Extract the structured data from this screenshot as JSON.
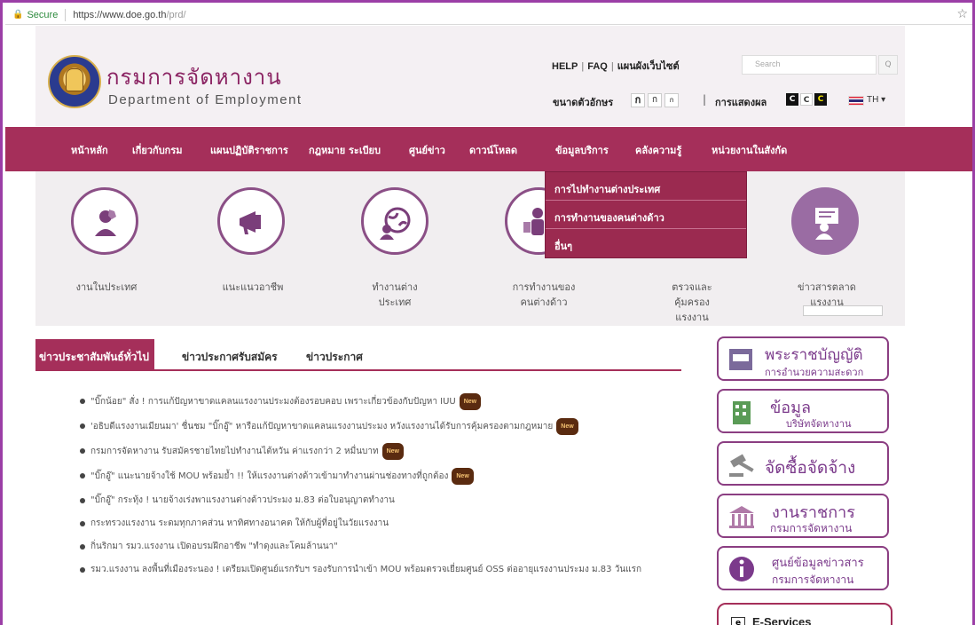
{
  "browser": {
    "secure_label": "Secure",
    "url_host": "https://www.doe.go.th",
    "url_path": "/prd/"
  },
  "header": {
    "title_th": "กรมการจัดหางาน",
    "title_en": "Department of Employment",
    "links": [
      "HELP",
      "FAQ",
      "แผนผังเว็บไซต์"
    ],
    "search_placeholder": "Search",
    "font_size_label": "ขนาดตัวอักษร",
    "font_size_options": [
      "ก",
      "ก",
      "ก"
    ],
    "display_label": "การแสดงผล",
    "contrast_options": [
      "C",
      "C",
      "C"
    ],
    "language": "TH"
  },
  "nav": {
    "items": [
      "หน้าหลัก",
      "เกี่ยวกับกรม",
      "แผนปฏิบัติราชการ",
      "กฎหมาย ระเบียบ",
      "ศูนย์ข่าว",
      "ดาวน์โหลด",
      "ข้อมูลบริการ",
      "คลังความรู้",
      "หน่วยงานในสังกัด"
    ],
    "dropdown": [
      "การไปทำงานต่างประเทศ",
      "การทำงานของคนต่างด้าว",
      "อื่นๆ"
    ]
  },
  "services": [
    {
      "line1": "งานในประเทศ",
      "line2": "",
      "line3": ""
    },
    {
      "line1": "แนะแนวอาชีพ",
      "line2": "",
      "line3": ""
    },
    {
      "line1": "ทำงานต่าง",
      "line2": "ประเทศ",
      "line3": ""
    },
    {
      "line1": "การทำงานของ",
      "line2": "คนต่างด้าว",
      "line3": ""
    },
    {
      "line1": "ตรวจและ",
      "line2": "คุ้มครอง",
      "line3": "แรงงาน"
    },
    {
      "line1": "ข่าวสารตลาด",
      "line2": "แรงงาน",
      "line3": ""
    }
  ],
  "news": {
    "tabs": [
      "ข่าวประชาสัมพันธ์ทั่วไป",
      "ข่าวประกาศรับสมัคร",
      "ข่าวประกาศ"
    ],
    "new_badge": "New",
    "items": [
      "\"บิ๊กน้อย\" สั่ง ! การแก้ปัญหาขาดแคลนแรงงานประมงต้องรอบคอบ เพราะเกี่ยวข้องกับปัญหา IUU",
      "'อธิบดีแรงงานเมียนมา' ชื่นชม \"บิ๊กอู๊\" หารือแก้ปัญหาขาดแคลนแรงงานประมง หวังแรงงานได้รับการคุ้มครองตามกฎหมาย",
      "กรมการจัดหางาน รับสมัครชายไทยไปทำงานไต้หวัน ค่าแรงกว่า 2 หมื่นบาท",
      "\"บิ๊กอู๊\" แนะนายจ้างใช้ MOU พร้อมย้ำ !! ให้แรงงานต่างด้าวเข้ามาทำงานผ่านช่องทางที่ถูกต้อง",
      "\"บิ๊กอู๊\" กระทุ้ง ! นายจ้างเร่งพาแรงงานต่างด้าวประมง ม.83 ต่อใบอนุญาตทำงาน",
      "กระทรวงแรงงาน ระดมทุกภาคส่วน หาทิศทางอนาคต ให้กับผู้ที่อยู่ในวัยแรงงาน",
      "กิ่นริกมา รมว.แรงงาน เปิดอบรมฝึกอาชีพ \"ทำดุงและโคมล้านนา\"",
      "รมว.แรงงาน ลงพื้นที่เมืองระนอง ! เตรียมเปิดศูนย์แรกรับฯ รองรับการนำเข้า MOU พร้อมตรวจเยี่ยมศูนย์ OSS ต่ออายุแรงงานประมง ม.83 วันแรก"
    ],
    "items_with_badge": [
      true,
      true,
      true,
      true,
      false,
      false,
      false,
      false
    ]
  },
  "sidebar": {
    "banners": [
      {
        "line1": "พระราชบัญญัติ",
        "line2": "การอำนวยความสะดวก"
      },
      {
        "line1": "ข้อมูล",
        "line2": "บริษัทจัดหางาน"
      },
      {
        "line1": "จัดซื้อจัดจ้าง",
        "line2": ""
      },
      {
        "line1": "งานราชการ",
        "line2": "กรมการจัดหางาน"
      },
      {
        "line1": "ศูนย์ข้อมูลข่าวสาร",
        "line2": "กรมการจัดหางาน"
      }
    ],
    "eservices": "E-Services"
  },
  "colors": {
    "accent": "#a52f5a",
    "purple": "#8b3e82",
    "frame": "#9b3fa6"
  }
}
